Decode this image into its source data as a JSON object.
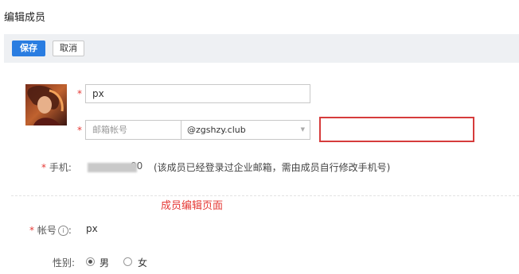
{
  "page": {
    "title": "编辑成员"
  },
  "toolbar": {
    "save_label": "保存",
    "cancel_label": "取消"
  },
  "form": {
    "required_mark": "*",
    "name_value": "px",
    "email_placeholder": "邮箱帐号",
    "email_domain": "@zgshzy.club",
    "phone_label": "手机:",
    "phone_value_visible": "00",
    "phone_note": "(该成员已经登录过企业邮箱，需由成员自行修改手机号)",
    "account_label": "帐号",
    "account_suffix": ":",
    "account_value": "px",
    "gender_label": "性别:",
    "gender_options": [
      "男",
      "女"
    ],
    "gender_selected": "男"
  },
  "annotation": {
    "text": "成员编辑页面",
    "color": "#e53935"
  },
  "colors": {
    "primary": "#2a7de1",
    "required": "#e53935",
    "highlight": "#d63c3c"
  },
  "icons": {
    "info": "info-circle-icon",
    "domain_dropdown": "caret-down-icon"
  }
}
